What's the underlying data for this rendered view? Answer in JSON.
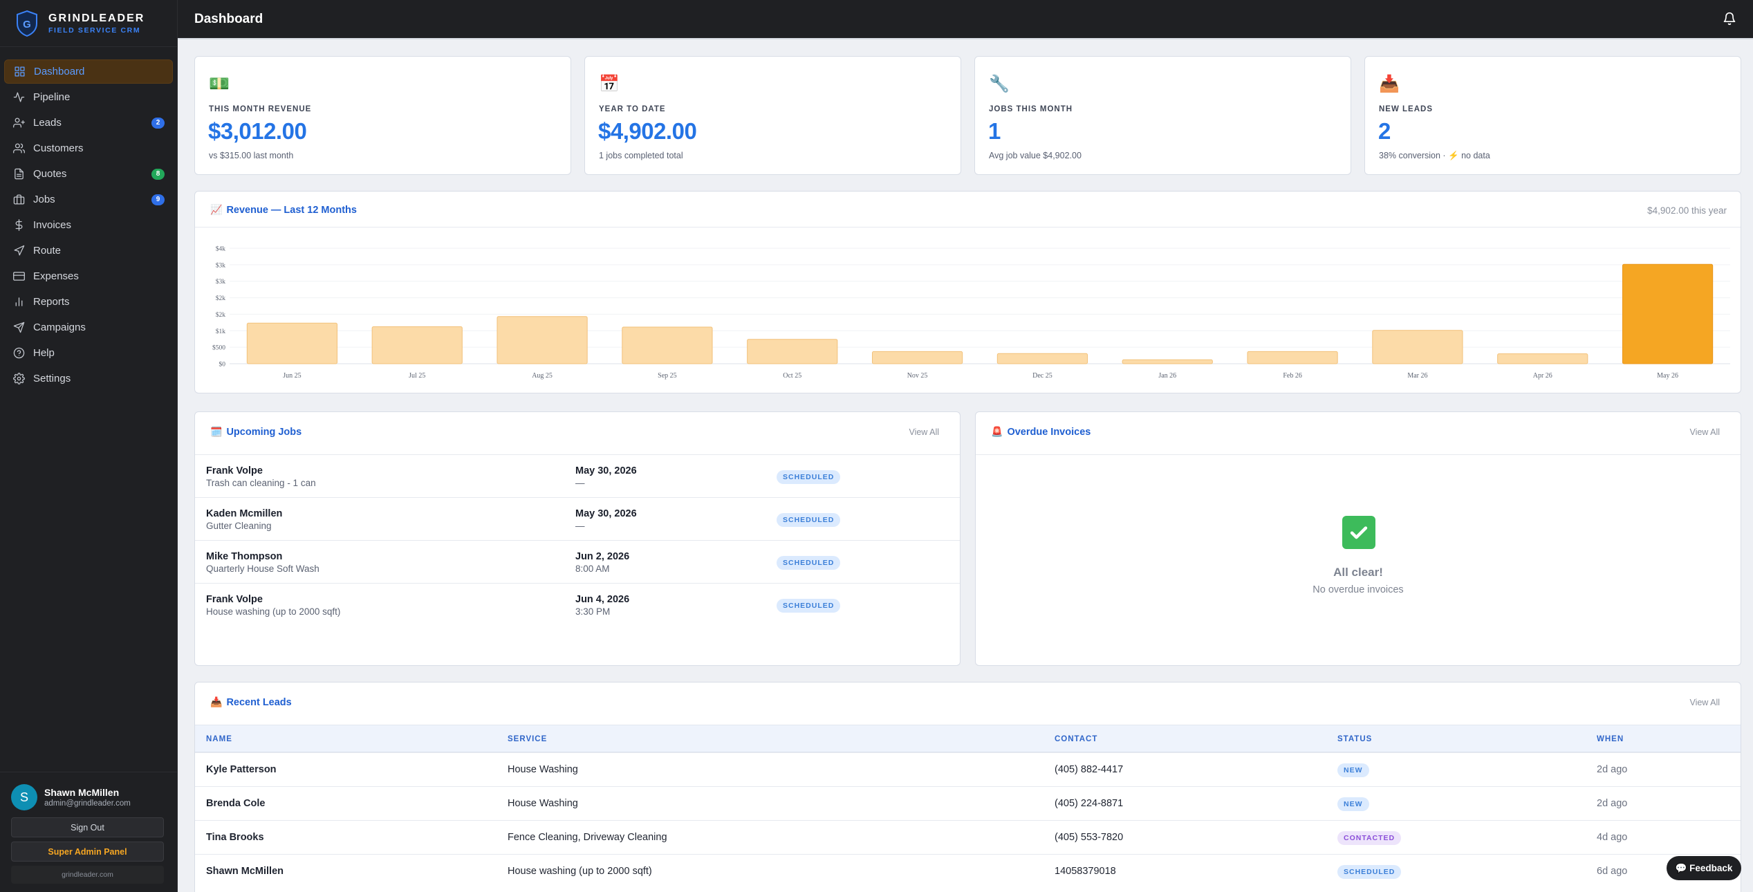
{
  "brand": {
    "name": "GRINDLEADER",
    "tagline": "FIELD SERVICE CRM",
    "logo_letter": "G"
  },
  "nav": [
    {
      "label": "Dashboard",
      "icon": "grid-icon",
      "active": true
    },
    {
      "label": "Pipeline",
      "icon": "activity-icon"
    },
    {
      "label": "Leads",
      "icon": "user-plus-icon",
      "badge": "2",
      "badge_color": "blue"
    },
    {
      "label": "Customers",
      "icon": "users-icon"
    },
    {
      "label": "Quotes",
      "icon": "file-text-icon",
      "badge": "8",
      "badge_color": "green"
    },
    {
      "label": "Jobs",
      "icon": "briefcase-icon",
      "badge": "9",
      "badge_color": "blue"
    },
    {
      "label": "Invoices",
      "icon": "dollar-icon"
    },
    {
      "label": "Route",
      "icon": "navigation-icon"
    },
    {
      "label": "Expenses",
      "icon": "credit-card-icon"
    },
    {
      "label": "Reports",
      "icon": "bar-chart-icon"
    },
    {
      "label": "Campaigns",
      "icon": "send-icon"
    },
    {
      "label": "Help",
      "icon": "help-icon"
    },
    {
      "label": "Settings",
      "icon": "gear-icon"
    }
  ],
  "user": {
    "initial": "S",
    "name": "Shawn McMillen",
    "email": "admin@grindleader.com"
  },
  "sidebar_buttons": {
    "sign_out": "Sign Out",
    "admin": "Super Admin Panel",
    "domain": "grindleader.com"
  },
  "topbar": {
    "title": "Dashboard"
  },
  "stats": [
    {
      "emoji": "💵",
      "label": "THIS MONTH REVENUE",
      "value": "$3,012.00",
      "sub": "vs $315.00 last month"
    },
    {
      "emoji": "📅",
      "label": "YEAR TO DATE",
      "value": "$4,902.00",
      "sub": "1 jobs completed total"
    },
    {
      "emoji": "🔧",
      "label": "JOBS THIS MONTH",
      "value": "1",
      "sub": "Avg job value $4,902.00"
    },
    {
      "emoji": "📥",
      "label": "NEW LEADS",
      "value": "2",
      "sub": "38% conversion · ⚡ no data"
    }
  ],
  "revenue": {
    "emoji": "📈",
    "title": "Revenue — Last 12 Months",
    "total": "$4,902.00 this year"
  },
  "chart_data": {
    "type": "bar",
    "categories": [
      "Jun 25",
      "Jul 25",
      "Aug 25",
      "Sep 25",
      "Oct 25",
      "Nov 25",
      "Dec 25",
      "Jan 26",
      "Feb 26",
      "Mar 26",
      "Apr 26",
      "May 26"
    ],
    "values": [
      1230,
      1120,
      1430,
      1110,
      740,
      370,
      310,
      120,
      370,
      1010,
      300,
      3012
    ],
    "highlight_index": 11,
    "ylim": [
      0,
      3500
    ],
    "yticks": [
      0,
      500,
      1000,
      1500,
      2000,
      2500,
      3000,
      3500
    ],
    "ytick_labels": [
      "$0",
      "$500",
      "$1k",
      "$2k",
      "$2k",
      "$3k",
      "$3k",
      "$4k"
    ],
    "bar_color": "#fcdba8",
    "highlight_color": "#f5a623",
    "grid": true
  },
  "upcoming": {
    "emoji": "🗓️",
    "title": "Upcoming Jobs",
    "view_all": "View All",
    "rows": [
      {
        "name": "Frank Volpe",
        "service": "Trash can cleaning - 1 can",
        "date": "May 30, 2026",
        "time": "—",
        "status": "SCHEDULED"
      },
      {
        "name": "Kaden Mcmillen",
        "service": "Gutter Cleaning",
        "date": "May 30, 2026",
        "time": "—",
        "status": "SCHEDULED"
      },
      {
        "name": "Mike Thompson",
        "service": "Quarterly House Soft Wash",
        "date": "Jun 2, 2026",
        "time": "8:00 AM",
        "status": "SCHEDULED"
      },
      {
        "name": "Frank Volpe",
        "service": "House washing (up to 2000 sqft)",
        "date": "Jun 4, 2026",
        "time": "3:30 PM",
        "status": "SCHEDULED"
      }
    ]
  },
  "overdue": {
    "emoji": "🚨",
    "title": "Overdue Invoices",
    "view_all": "View All",
    "empty_title": "All clear!",
    "empty_sub": "No overdue invoices"
  },
  "leads": {
    "emoji": "📥",
    "title": "Recent Leads",
    "view_all": "View All",
    "headers": [
      "NAME",
      "SERVICE",
      "CONTACT",
      "STATUS",
      "WHEN"
    ],
    "rows": [
      {
        "name": "Kyle Patterson",
        "service": "House Washing",
        "contact": "(405) 882-4417",
        "status": "NEW",
        "when": "2d ago"
      },
      {
        "name": "Brenda Cole",
        "service": "House Washing",
        "contact": "(405) 224-8871",
        "status": "NEW",
        "when": "2d ago"
      },
      {
        "name": "Tina Brooks",
        "service": "Fence Cleaning, Driveway Cleaning",
        "contact": "(405) 553-7820",
        "status": "CONTACTED",
        "when": "4d ago"
      },
      {
        "name": "Shawn McMillen",
        "service": "House washing (up to 2000 sqft)",
        "contact": "14058379018",
        "status": "SCHEDULED",
        "when": "6d ago"
      }
    ]
  },
  "feedback": "💬 Feedback"
}
